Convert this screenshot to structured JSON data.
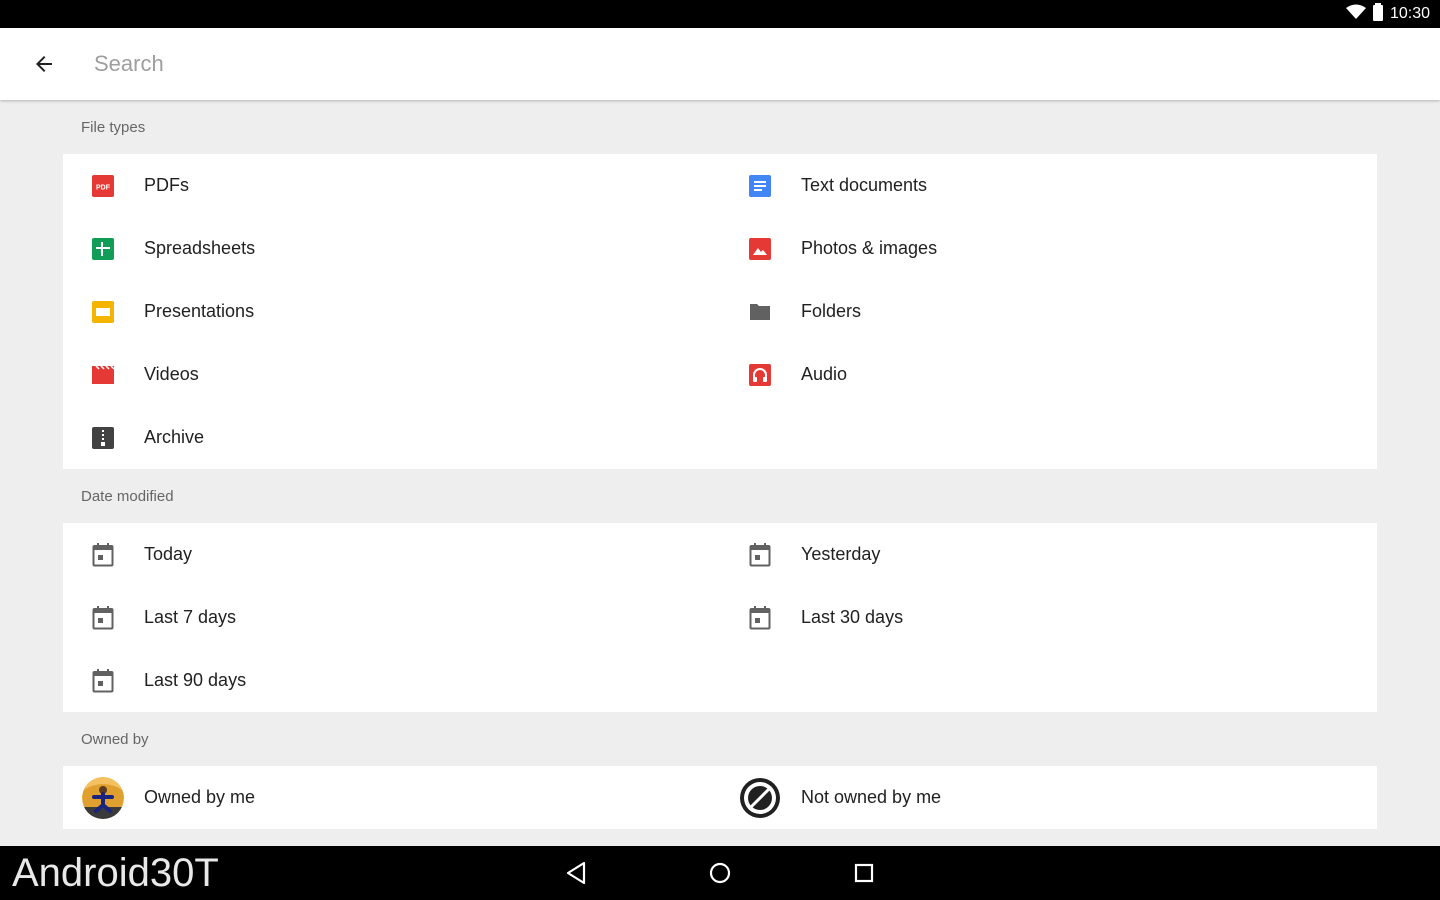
{
  "status_bar": {
    "time": "10:30",
    "icons": [
      "wifi-icon",
      "battery-icon"
    ]
  },
  "search": {
    "placeholder": "Search",
    "value": ""
  },
  "sections": {
    "file_types": {
      "title": "File types",
      "items": [
        {
          "label": "PDFs",
          "icon": "pdf-icon",
          "color": "#e53935"
        },
        {
          "label": "Text documents",
          "icon": "doc-icon",
          "color": "#4285f4"
        },
        {
          "label": "Spreadsheets",
          "icon": "sheet-icon",
          "color": "#0f9d58"
        },
        {
          "label": "Photos & images",
          "icon": "image-icon",
          "color": "#e53935"
        },
        {
          "label": "Presentations",
          "icon": "slides-icon",
          "color": "#f4b400"
        },
        {
          "label": "Folders",
          "icon": "folder-icon",
          "color": "#616161"
        },
        {
          "label": "Videos",
          "icon": "video-icon",
          "color": "#e53935"
        },
        {
          "label": "Audio",
          "icon": "audio-icon",
          "color": "#e53935"
        },
        {
          "label": "Archive",
          "icon": "archive-icon",
          "color": "#424242"
        }
      ]
    },
    "date_modified": {
      "title": "Date modified",
      "items": [
        {
          "label": "Today",
          "icon": "calendar-icon"
        },
        {
          "label": "Yesterday",
          "icon": "calendar-icon"
        },
        {
          "label": "Last 7 days",
          "icon": "calendar-icon"
        },
        {
          "label": "Last 30 days",
          "icon": "calendar-icon"
        },
        {
          "label": "Last 90 days",
          "icon": "calendar-icon"
        }
      ]
    },
    "owned_by": {
      "title": "Owned by",
      "items": [
        {
          "label": "Owned by me",
          "icon": "user-avatar-icon"
        },
        {
          "label": "Not owned by me",
          "icon": "not-owned-avatar-icon"
        }
      ]
    }
  },
  "nav_bar": {
    "buttons": [
      "back-nav-icon",
      "home-nav-icon",
      "recents-nav-icon"
    ]
  },
  "watermark": "Android30T"
}
